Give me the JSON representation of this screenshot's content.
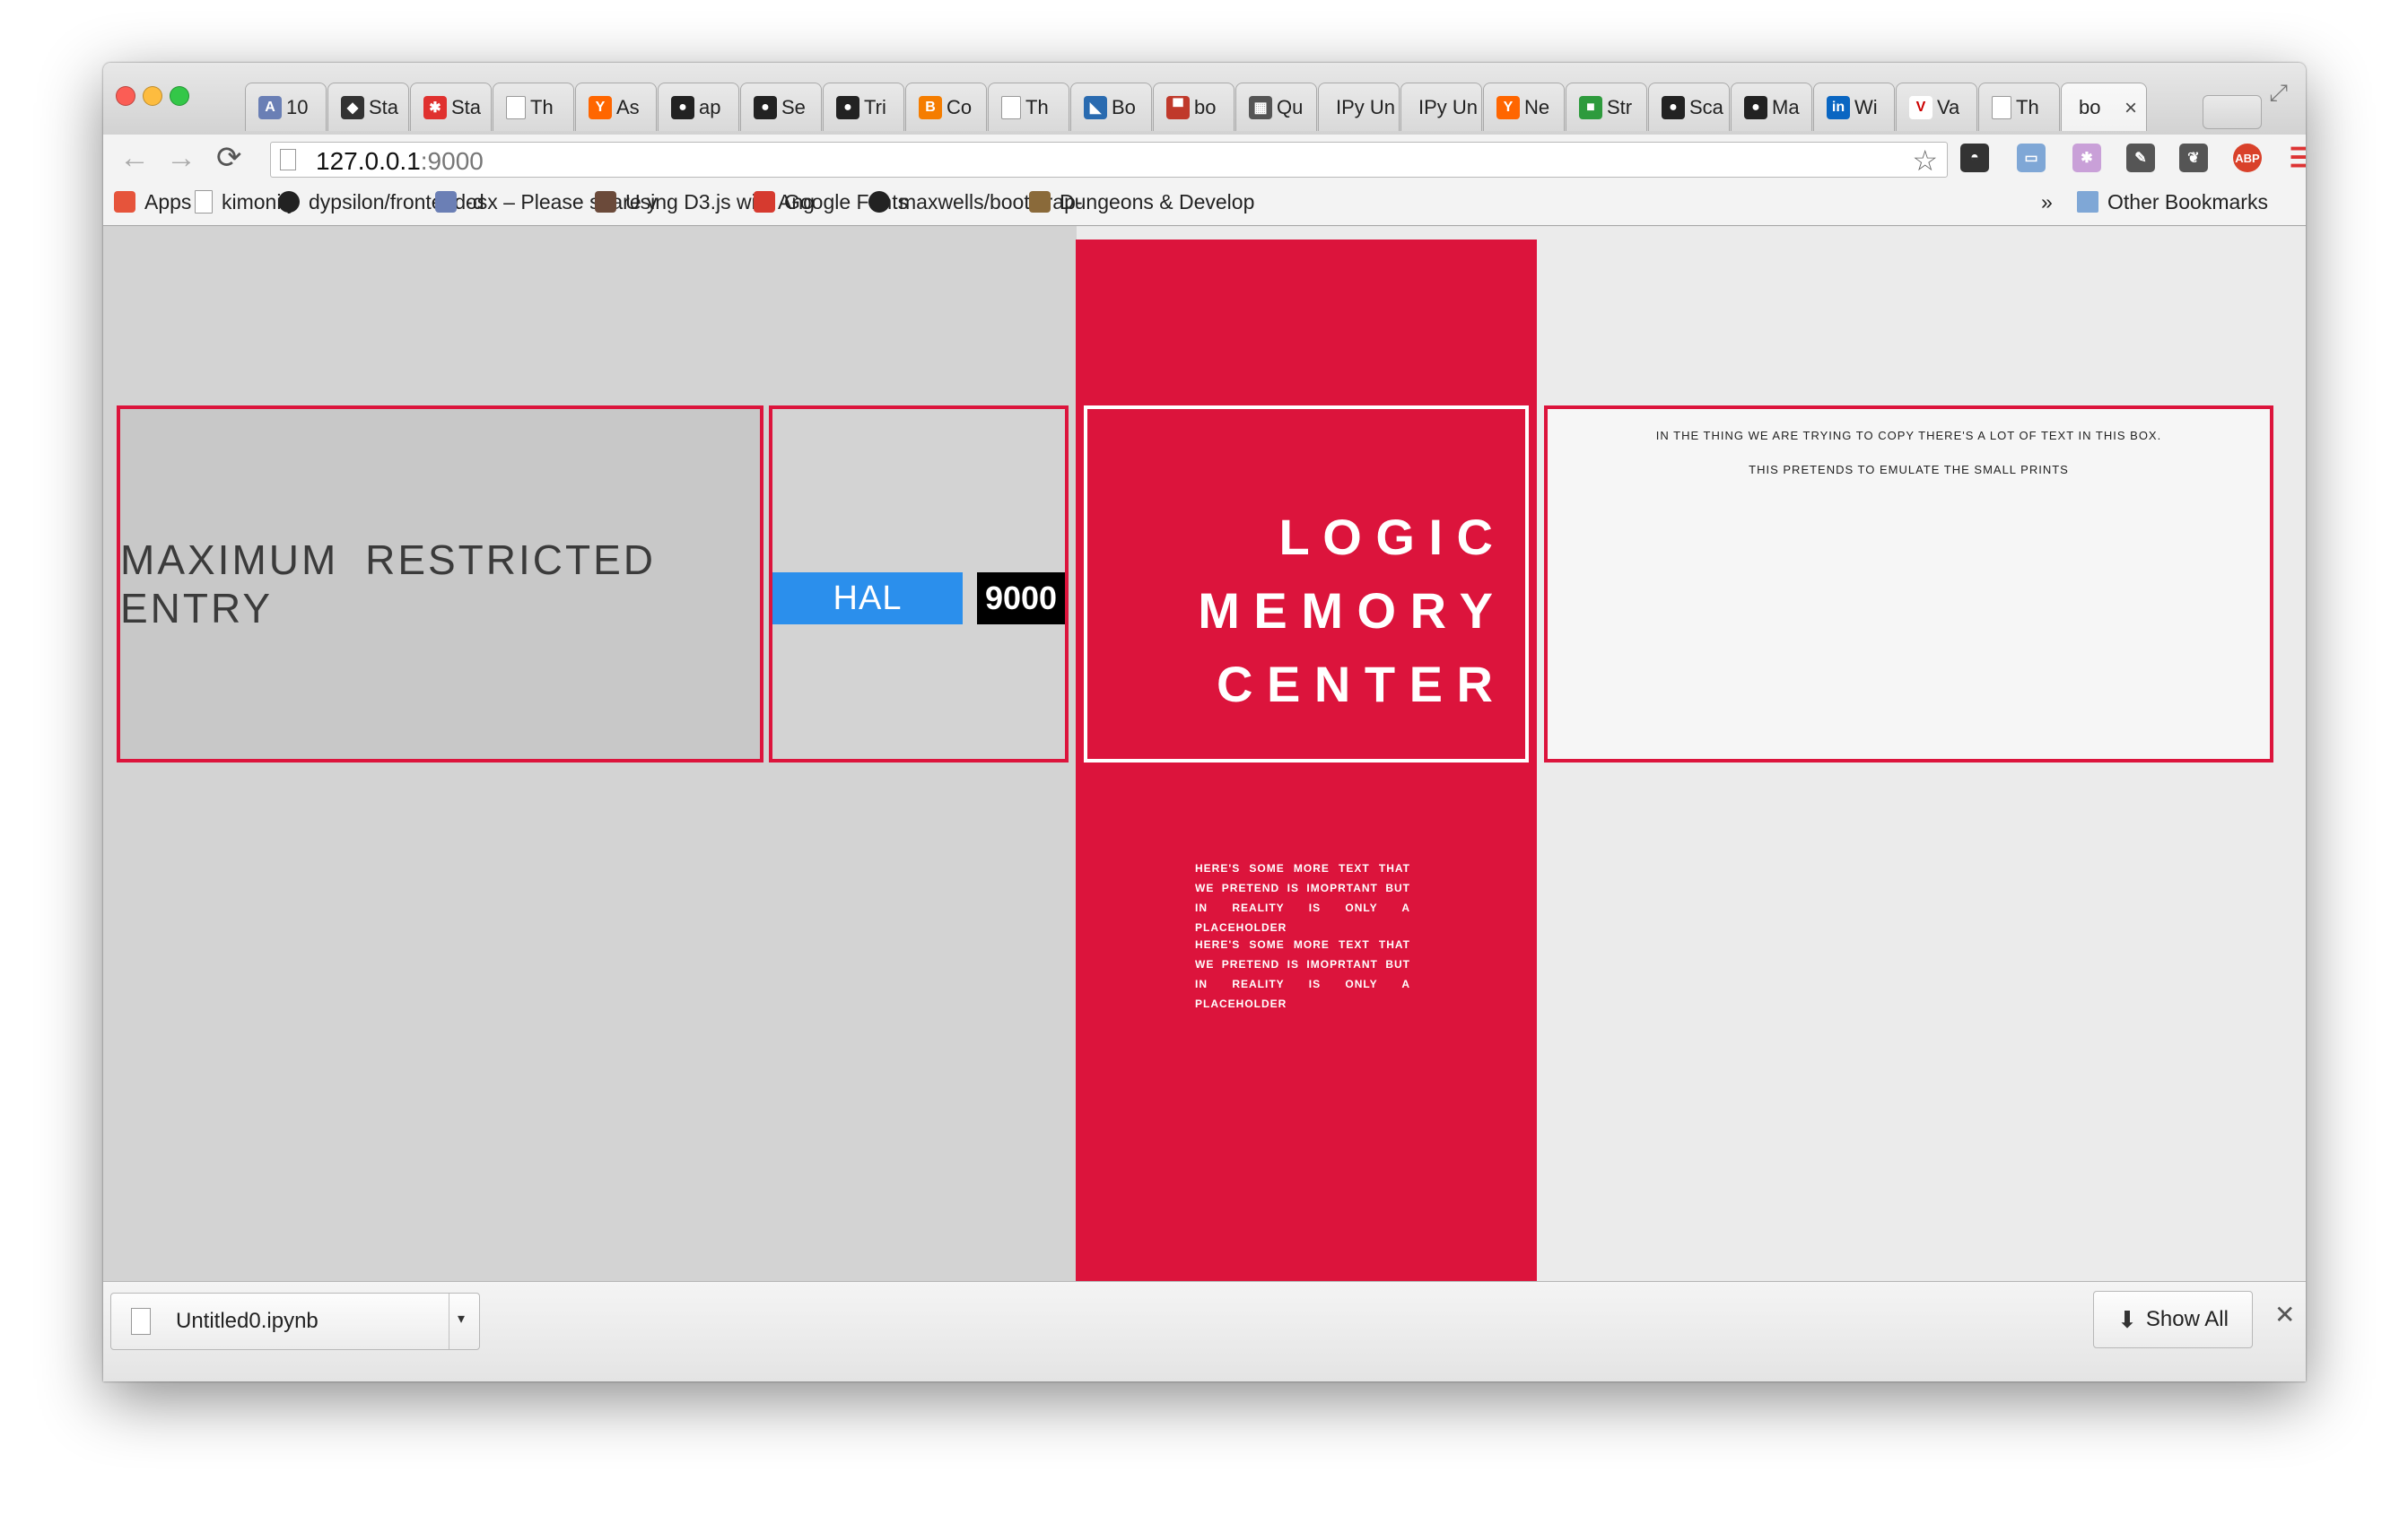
{
  "tabs": [
    {
      "title": "10",
      "icon": "circle-a-icon",
      "color": "#6a7fb5"
    },
    {
      "title": "Sta",
      "icon": "diamond-icon",
      "color": "#333333"
    },
    {
      "title": "Sta",
      "icon": "bug-icon",
      "color": "#e0312f"
    },
    {
      "title": "Th",
      "icon": "page-icon",
      "color": "#ffffff"
    },
    {
      "title": "As",
      "icon": "ycombinator-icon",
      "color": "#ff6600"
    },
    {
      "title": "ap",
      "icon": "github-icon",
      "color": "#222222"
    },
    {
      "title": "Se",
      "icon": "github-icon",
      "color": "#222222"
    },
    {
      "title": "Tri",
      "icon": "github-icon",
      "color": "#222222"
    },
    {
      "title": "Co",
      "icon": "blogger-icon",
      "color": "#f57d00"
    },
    {
      "title": "Th",
      "icon": "page-icon",
      "color": "#ffffff"
    },
    {
      "title": "Bo",
      "icon": "bootstrap-icon",
      "color": "#2a6bb0"
    },
    {
      "title": "bo",
      "icon": "hat-icon",
      "color": "#c0392b"
    },
    {
      "title": "Qu",
      "icon": "grid-icon",
      "color": "#555555"
    },
    {
      "title": "IPy Un",
      "icon": "none",
      "color": "#ffffff"
    },
    {
      "title": "IPy Un",
      "icon": "none",
      "color": "#ffffff"
    },
    {
      "title": "Ne",
      "icon": "ycombinator-icon",
      "color": "#ff6600"
    },
    {
      "title": "Str",
      "icon": "cube-icon",
      "color": "#2e9b3d"
    },
    {
      "title": "Sca",
      "icon": "github-icon",
      "color": "#222222"
    },
    {
      "title": "Ma",
      "icon": "github-icon",
      "color": "#222222"
    },
    {
      "title": "Wi",
      "icon": "linkedin-icon",
      "color": "#0a66c2"
    },
    {
      "title": "Va",
      "icon": "v-icon",
      "color": "#cc0000"
    },
    {
      "title": "Th",
      "icon": "page-icon",
      "color": "#ffffff"
    },
    {
      "title": "bo",
      "icon": "none",
      "color": "#ffffff",
      "active": true
    }
  ],
  "address": {
    "host": "127.0.0.1",
    "port": ":9000"
  },
  "bookmarks": [
    {
      "label": "Apps",
      "icon": "apps-grid-icon"
    },
    {
      "label": "kimonify",
      "icon": "page-icon"
    },
    {
      "label": "dypsilon/frontend-d",
      "icon": "github-icon"
    },
    {
      "label": "osx – Please share y",
      "icon": "command-icon"
    },
    {
      "label": "Using D3.js with Ang",
      "icon": "photo-icon"
    },
    {
      "label": "Google Fonts",
      "icon": "google-fonts-icon"
    },
    {
      "label": "maxwells/bootstrap-",
      "icon": "github-icon"
    },
    {
      "label": "Dungeons & Develop",
      "icon": "gear-ring-icon"
    }
  ],
  "bookmarks_overflow": "»",
  "other_bookmarks": "Other Bookmarks",
  "content": {
    "restricted": "MAXIMUM RESTRICTED ENTRY",
    "hal": "HAL",
    "hal_number": "9000",
    "logic_lines": [
      "L O G I C",
      "M E M O R Y",
      "C E N T E R"
    ],
    "small_print_1": "IN THE THING WE ARE TRYING TO COPY THERE'S A LOT OF TEXT IN THIS BOX.",
    "small_print_2": "THIS PRETENDS TO EMULATE THE SMALL PRINTS",
    "red_paragraph_1": "HERE'S SOME MORE TEXT THAT WE PRETEND IS IMOPRTANT BUT IN REALITY IS ONLY A PLACEHOLDER",
    "red_paragraph_2": "HERE'S SOME MORE TEXT THAT WE PRETEND IS IMOPRTANT BUT IN REALITY IS ONLY A PLACEHOLDER"
  },
  "download": {
    "filename": "Untitled0.ipynb",
    "show_all": "Show All"
  },
  "colors": {
    "accent_red": "#dc143c",
    "hal_blue": "#2b8fec"
  }
}
